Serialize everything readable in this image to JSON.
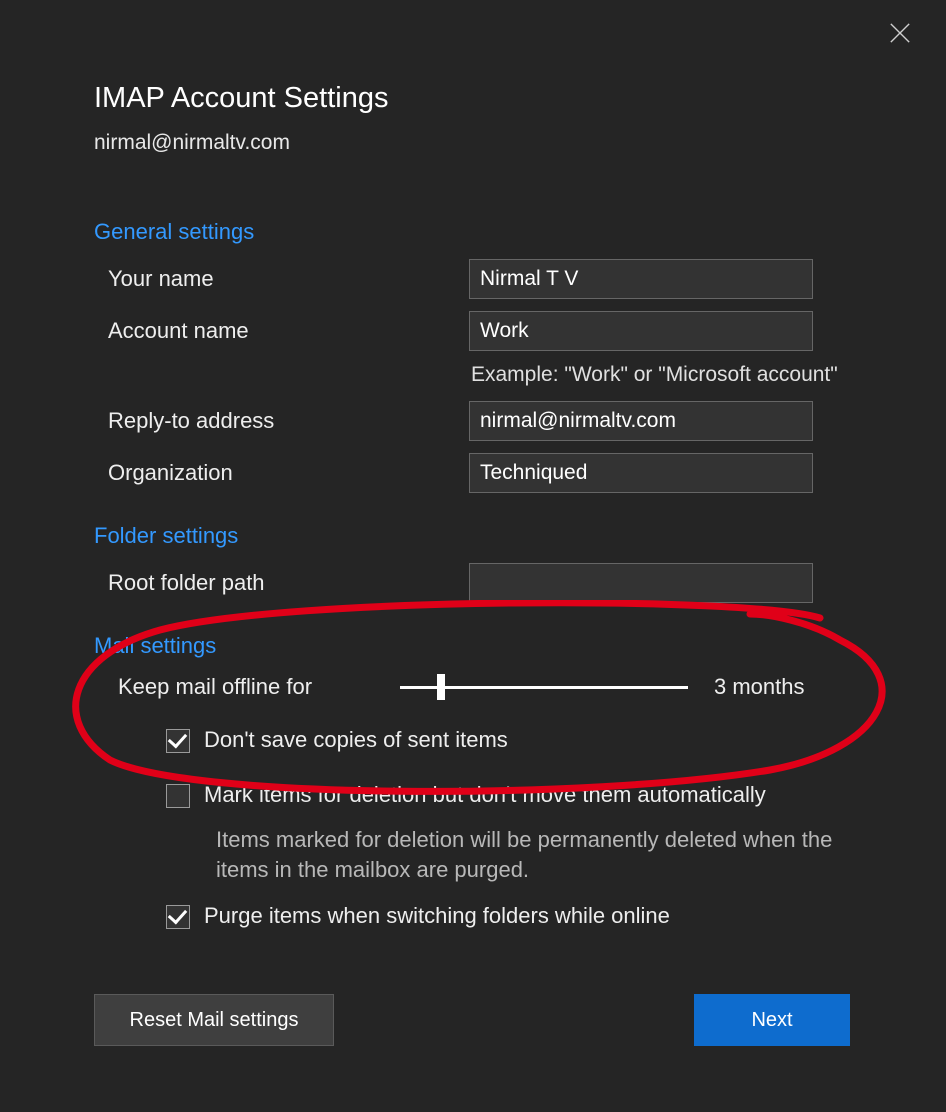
{
  "header": {
    "title": "IMAP Account Settings",
    "email": "nirmal@nirmaltv.com"
  },
  "general": {
    "section_label": "General settings",
    "your_name_label": "Your name",
    "your_name_value": "Nirmal T V",
    "account_name_label": "Account name",
    "account_name_value": "Work",
    "account_name_example": "Example: \"Work\" or \"Microsoft account\"",
    "reply_to_label": "Reply-to address",
    "reply_to_value": "nirmal@nirmaltv.com",
    "organization_label": "Organization",
    "organization_value": "Techniqued"
  },
  "folder": {
    "section_label": "Folder settings",
    "root_path_label": "Root folder path",
    "root_path_value": ""
  },
  "mail": {
    "section_label": "Mail settings",
    "keep_offline_label": "Keep mail offline for",
    "keep_offline_value": "3 months",
    "dont_save_sent_label": "Don't save copies of sent items",
    "dont_save_sent_checked": true,
    "mark_delete_label": "Mark items for deletion but don't move them automatically",
    "mark_delete_checked": false,
    "mark_delete_note": "Items marked for deletion will be permanently deleted when the items in the mailbox are purged.",
    "purge_label": "Purge items when switching folders while online",
    "purge_checked": true
  },
  "buttons": {
    "reset_label": "Reset Mail settings",
    "next_label": "Next"
  }
}
